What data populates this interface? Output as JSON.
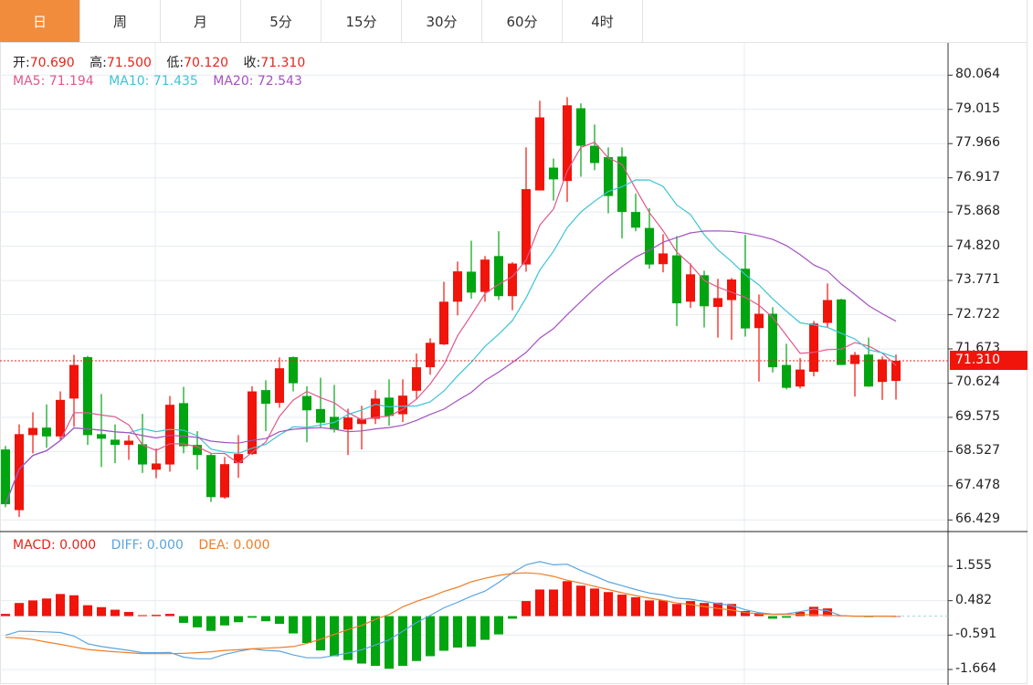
{
  "tabs": [
    {
      "label": "日",
      "active": true
    },
    {
      "label": "周",
      "active": false
    },
    {
      "label": "月",
      "active": false
    },
    {
      "label": "5分",
      "active": false
    },
    {
      "label": "15分",
      "active": false
    },
    {
      "label": "30分",
      "active": false
    },
    {
      "label": "60分",
      "active": false
    },
    {
      "label": "4时",
      "active": false
    }
  ],
  "ohlc_legend": {
    "open_label": "开:",
    "open": "70.690",
    "high_label": "高:",
    "high": "71.500",
    "low_label": "低:",
    "low": "70.120",
    "close_label": "收:",
    "close": "71.310"
  },
  "ma_legend": {
    "ma5": "MA5: 71.194",
    "ma10": "MA10: 71.435",
    "ma20": "MA20: 72.543"
  },
  "macd_legend": {
    "macd": "MACD: 0.000",
    "diff": "DIFF: 0.000",
    "dea": "DEA: 0.000"
  },
  "current_price": "71.310",
  "colors": {
    "up": "#f0140a",
    "down": "#00a510",
    "ma5": "#e0588a",
    "ma10": "#3cc4d6",
    "ma20": "#a451c0",
    "diff": "#5aa5e0",
    "dea": "#f07d28",
    "active_tab": "#f08c3c"
  },
  "chart_data": [
    {
      "type": "candlestick",
      "y_ticks": [
        "80.064",
        "79.015",
        "77.966",
        "76.917",
        "75.868",
        "74.820",
        "73.771",
        "72.722",
        "71.673",
        "70.624",
        "69.575",
        "68.527",
        "67.478",
        "66.429"
      ],
      "ylim": [
        66.429,
        80.064
      ],
      "grid": true,
      "fields": [
        "open",
        "high",
        "low",
        "close"
      ],
      "candles": [
        [
          68.59,
          68.7,
          66.82,
          66.91
        ],
        [
          66.73,
          69.36,
          66.52,
          69.06
        ],
        [
          69.03,
          69.73,
          68.47,
          69.25
        ],
        [
          69.26,
          69.97,
          68.64,
          68.99
        ],
        [
          68.99,
          70.37,
          68.89,
          70.11
        ],
        [
          70.15,
          71.49,
          69.29,
          71.18
        ],
        [
          71.42,
          71.46,
          68.73,
          69.03
        ],
        [
          69.06,
          70.29,
          68.05,
          68.92
        ],
        [
          68.89,
          69.36,
          68.17,
          68.73
        ],
        [
          68.73,
          69.03,
          68.27,
          68.86
        ],
        [
          68.75,
          69.68,
          67.87,
          68.13
        ],
        [
          67.97,
          68.62,
          67.71,
          68.16
        ],
        [
          68.13,
          70.23,
          67.91,
          69.96
        ],
        [
          70.01,
          70.51,
          68.47,
          68.69
        ],
        [
          68.73,
          69.15,
          67.97,
          68.42
        ],
        [
          68.42,
          68.47,
          66.98,
          67.13
        ],
        [
          67.12,
          68.36,
          67.08,
          68.14
        ],
        [
          68.17,
          69.03,
          67.72,
          68.45
        ],
        [
          68.45,
          70.53,
          68.42,
          70.37
        ],
        [
          70.41,
          70.71,
          69.15,
          69.99
        ],
        [
          70.02,
          71.41,
          69.87,
          71.08
        ],
        [
          71.42,
          71.44,
          70.37,
          70.62
        ],
        [
          70.23,
          70.53,
          68.81,
          69.79
        ],
        [
          69.83,
          70.79,
          69.25,
          69.41
        ],
        [
          69.59,
          70.57,
          69.11,
          69.2
        ],
        [
          69.2,
          69.84,
          68.42,
          69.57
        ],
        [
          69.37,
          69.93,
          68.59,
          69.53
        ],
        [
          69.53,
          70.41,
          69.37,
          70.15
        ],
        [
          70.18,
          70.74,
          69.32,
          69.62
        ],
        [
          69.67,
          70.74,
          69.43,
          70.24
        ],
        [
          70.39,
          71.53,
          70.13,
          71.11
        ],
        [
          71.11,
          72.0,
          70.88,
          71.86
        ],
        [
          71.81,
          73.73,
          71.79,
          73.12
        ],
        [
          73.12,
          74.35,
          72.7,
          74.05
        ],
        [
          74.04,
          74.99,
          73.21,
          73.4
        ],
        [
          73.42,
          74.52,
          73.12,
          74.41
        ],
        [
          74.52,
          75.28,
          73.17,
          73.29
        ],
        [
          73.29,
          74.33,
          72.86,
          74.29
        ],
        [
          74.26,
          77.85,
          74.04,
          76.57
        ],
        [
          76.53,
          79.28,
          76.53,
          78.77
        ],
        [
          77.23,
          77.51,
          76.22,
          76.87
        ],
        [
          76.82,
          79.39,
          76.18,
          79.14
        ],
        [
          79.05,
          79.2,
          76.95,
          77.9
        ],
        [
          77.9,
          78.55,
          77.15,
          77.37
        ],
        [
          77.55,
          77.85,
          75.83,
          76.36
        ],
        [
          77.57,
          77.85,
          75.06,
          75.87
        ],
        [
          75.87,
          76.43,
          75.28,
          75.39
        ],
        [
          75.38,
          75.99,
          74.13,
          74.26
        ],
        [
          74.27,
          75.19,
          74.02,
          74.6
        ],
        [
          74.54,
          75.13,
          72.37,
          73.07
        ],
        [
          73.12,
          74.29,
          72.93,
          73.96
        ],
        [
          73.93,
          74.07,
          72.33,
          72.98
        ],
        [
          72.96,
          73.82,
          72.02,
          73.23
        ],
        [
          73.17,
          73.85,
          71.95,
          73.8
        ],
        [
          74.13,
          75.17,
          72.05,
          72.3
        ],
        [
          72.31,
          73.34,
          70.67,
          72.75
        ],
        [
          72.75,
          72.95,
          70.95,
          71.11
        ],
        [
          71.18,
          71.83,
          70.43,
          70.48
        ],
        [
          70.52,
          71.39,
          70.46,
          71.04
        ],
        [
          70.97,
          72.53,
          70.83,
          72.45
        ],
        [
          72.47,
          73.68,
          72.33,
          73.17
        ],
        [
          73.19,
          73.21,
          71.18,
          71.18
        ],
        [
          71.21,
          71.58,
          70.21,
          71.49
        ],
        [
          71.5,
          72.02,
          70.51,
          70.52
        ],
        [
          70.66,
          71.44,
          70.11,
          71.35
        ],
        [
          70.69,
          71.5,
          70.12,
          71.31
        ]
      ],
      "series": [
        {
          "name": "MA5",
          "period": 5
        },
        {
          "name": "MA10",
          "period": 10
        },
        {
          "name": "MA20",
          "period": 20
        }
      ],
      "last_price": 71.31
    },
    {
      "type": "bar+line",
      "y_ticks": [
        "1.555",
        "0.482",
        "-0.591",
        "-1.664"
      ],
      "ylim": [
        -1.664,
        1.555
      ],
      "grid": true,
      "macd": [
        0.07,
        0.41,
        0.49,
        0.55,
        0.69,
        0.65,
        0.34,
        0.28,
        0.2,
        0.13,
        0.03,
        0.04,
        0.07,
        -0.21,
        -0.35,
        -0.46,
        -0.29,
        -0.19,
        -0.05,
        -0.16,
        -0.24,
        -0.54,
        -0.84,
        -1.07,
        -1.25,
        -1.37,
        -1.48,
        -1.55,
        -1.64,
        -1.55,
        -1.4,
        -1.25,
        -1.08,
        -0.98,
        -0.95,
        -0.74,
        -0.57,
        -0.08,
        0.47,
        0.83,
        0.83,
        1.09,
        0.95,
        0.86,
        0.75,
        0.67,
        0.59,
        0.49,
        0.49,
        0.38,
        0.47,
        0.41,
        0.42,
        0.38,
        0.16,
        0.1,
        -0.08,
        -0.05,
        0.13,
        0.29,
        0.24,
        0.02,
        0.01,
        -0.03,
        0.01,
        0.0
      ],
      "series": [
        {
          "name": "DIFF",
          "values": [
            -0.6,
            -0.47,
            -0.48,
            -0.49,
            -0.51,
            -0.62,
            -0.86,
            -0.95,
            -1.01,
            -1.07,
            -1.14,
            -1.14,
            -1.13,
            -1.28,
            -1.33,
            -1.33,
            -1.19,
            -1.1,
            -1.02,
            -1.07,
            -1.09,
            -1.21,
            -1.3,
            -1.3,
            -1.23,
            -1.15,
            -1.05,
            -0.9,
            -0.74,
            -0.47,
            -0.2,
            0.02,
            0.26,
            0.43,
            0.62,
            0.78,
            1.05,
            1.35,
            1.6,
            1.7,
            1.6,
            1.62,
            1.42,
            1.25,
            1.07,
            0.95,
            0.83,
            0.72,
            0.66,
            0.56,
            0.53,
            0.46,
            0.39,
            0.33,
            0.2,
            0.11,
            0.06,
            0.07,
            0.14,
            0.22,
            0.17,
            0.01,
            0.0,
            0.0,
            0.0,
            0.0
          ]
        },
        {
          "name": "DEA",
          "values": [
            -0.66,
            -0.68,
            -0.73,
            -0.81,
            -0.88,
            -0.96,
            -1.04,
            -1.08,
            -1.11,
            -1.14,
            -1.17,
            -1.17,
            -1.17,
            -1.16,
            -1.14,
            -1.11,
            -1.07,
            -1.05,
            -1.02,
            -1.0,
            -0.98,
            -0.95,
            -0.85,
            -0.72,
            -0.57,
            -0.42,
            -0.29,
            -0.1,
            0.05,
            0.29,
            0.46,
            0.6,
            0.77,
            0.9,
            1.07,
            1.18,
            1.27,
            1.33,
            1.35,
            1.32,
            1.24,
            1.12,
            1.03,
            0.93,
            0.83,
            0.73,
            0.64,
            0.56,
            0.49,
            0.41,
            0.36,
            0.3,
            0.24,
            0.19,
            0.11,
            0.07,
            0.05,
            0.05,
            0.05,
            0.04,
            0.03,
            0.01,
            0.0,
            0.0,
            0.0,
            0.0
          ]
        }
      ]
    }
  ]
}
